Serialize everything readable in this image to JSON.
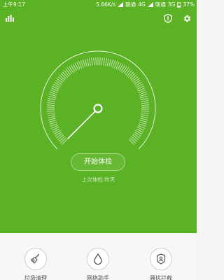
{
  "status": {
    "time": "上午9:17",
    "speed": "5.66K/s",
    "sim1_carrier": "联通",
    "sim1_net": "4G",
    "sim2_carrier": "联通",
    "sim2_net": "3G",
    "battery": "37%"
  },
  "main": {
    "start_label": "开始体检",
    "last_check": "上次体检:昨天"
  },
  "tools": [
    {
      "label": "垃圾清理",
      "icon": "broom-icon"
    },
    {
      "label": "网络助手",
      "icon": "droplet-icon"
    },
    {
      "label": "骚扰拦截",
      "icon": "shield-person-icon"
    }
  ],
  "colors": {
    "primary": "#5bb224",
    "bottom_bg": "#f7f7f7"
  }
}
